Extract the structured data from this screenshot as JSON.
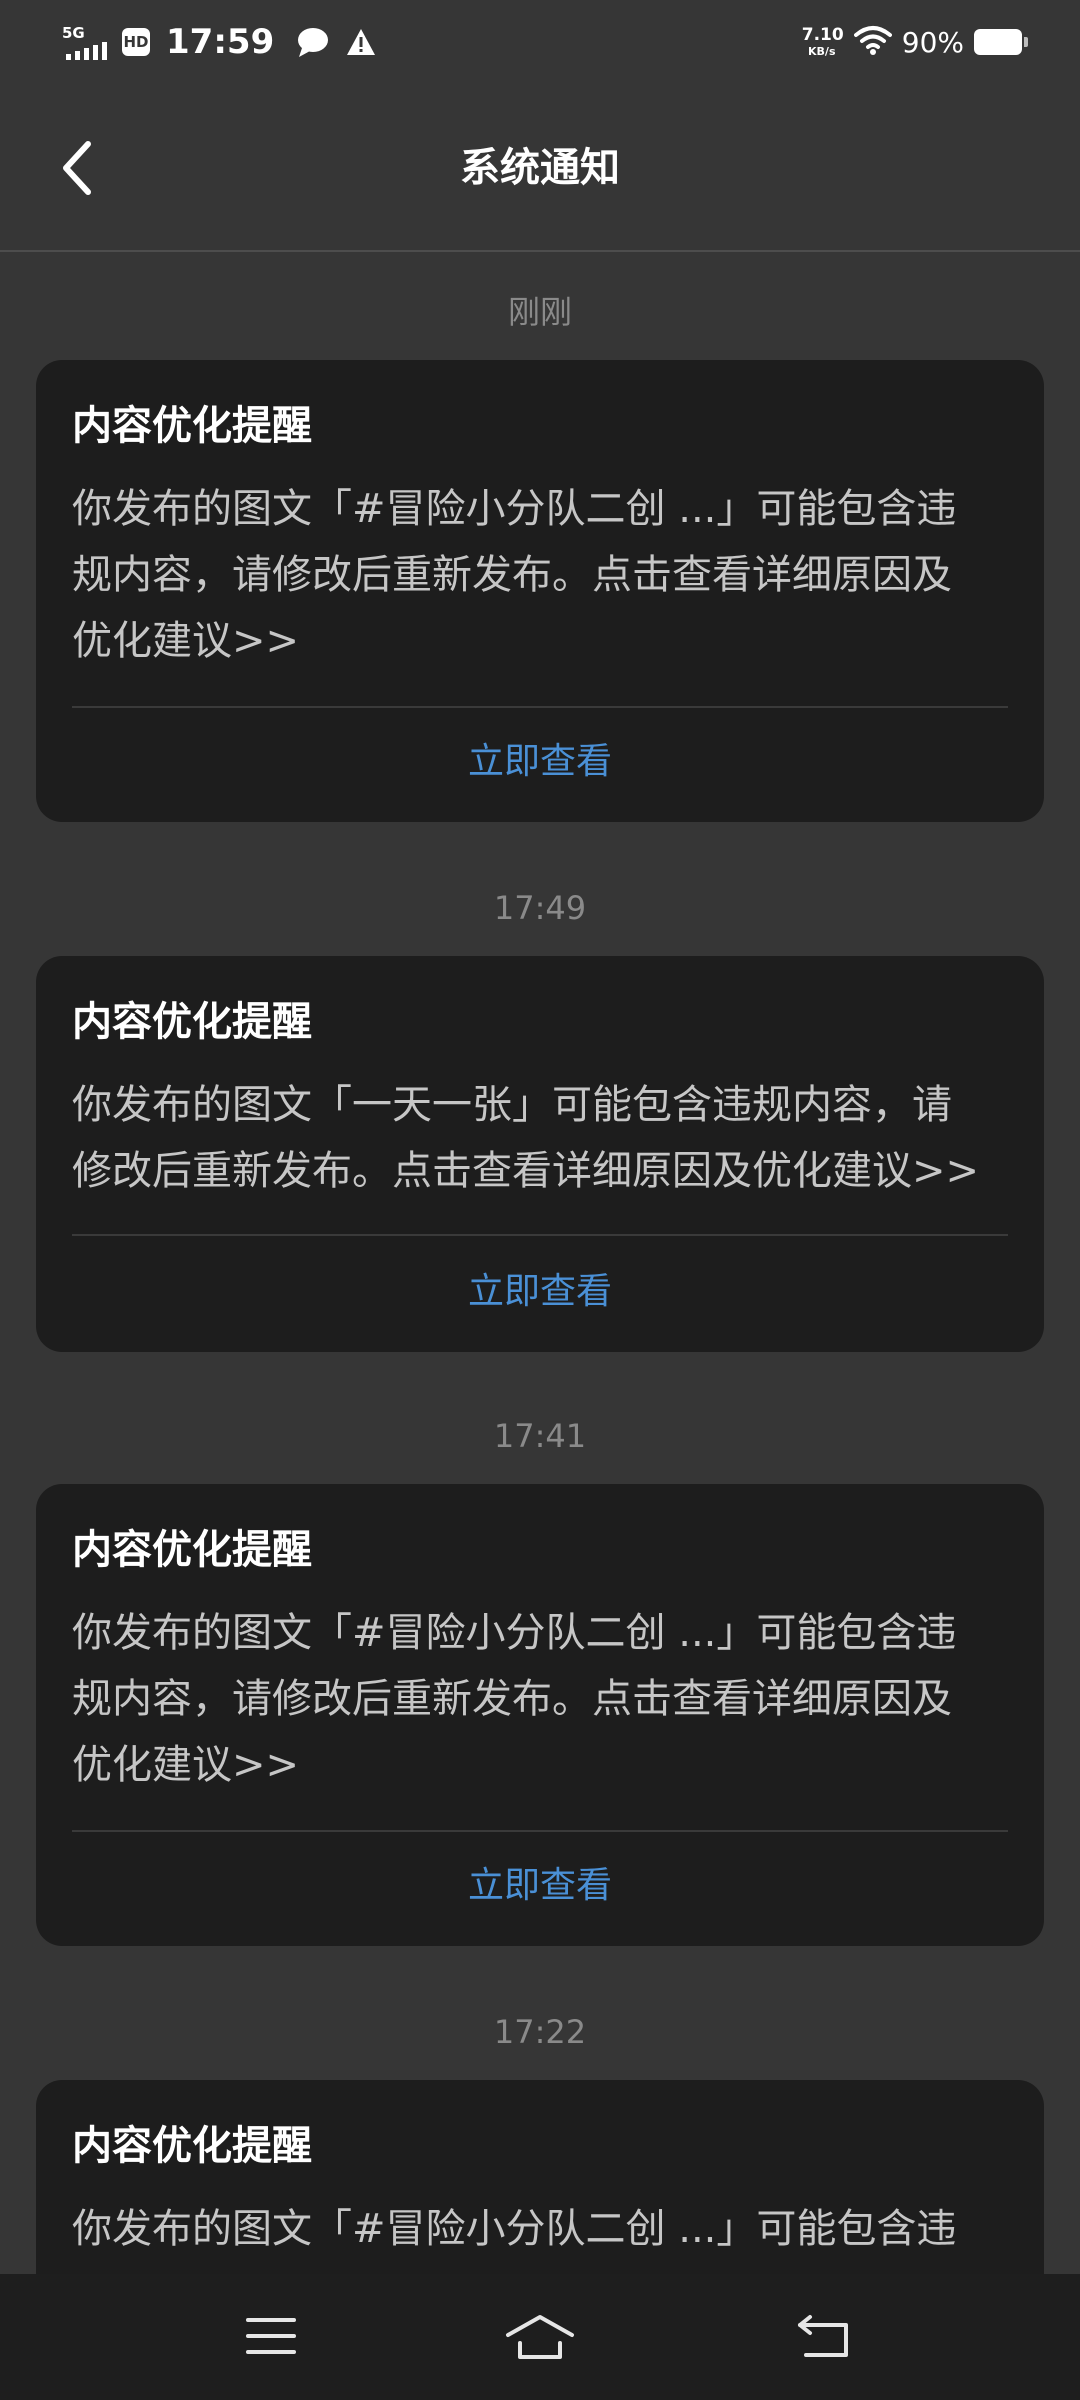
{
  "status_bar": {
    "network": "5G",
    "hd": "HD",
    "time": "17:59",
    "speed_value": "7.10",
    "speed_unit": "KB/s",
    "battery": "90%",
    "icons": [
      "signal-icon",
      "hd-icon",
      "message-icon",
      "warning-icon",
      "wifi-icon",
      "battery-icon"
    ]
  },
  "header": {
    "back_icon": "chevron-left-icon",
    "title": "系统通知"
  },
  "notifications": [
    {
      "time": "刚刚",
      "title": "内容优化提醒",
      "body_lines": [
        "你发布的图文「#冒险小分队二创 ...」可能包含违",
        "规内容，请修改后重新发布。点击查看详细原因及",
        "优化建议>>"
      ],
      "action": "立即查看"
    },
    {
      "time": "17:49",
      "title": "内容优化提醒",
      "body_lines": [
        "你发布的图文「一天一张」可能包含违规内容，请",
        "修改后重新发布。点击查看详细原因及优化建议>>"
      ],
      "action": "立即查看"
    },
    {
      "time": "17:41",
      "title": "内容优化提醒",
      "body_lines": [
        "你发布的图文「#冒险小分队二创 ...」可能包含违",
        "规内容，请修改后重新发布。点击查看详细原因及",
        "优化建议>>"
      ],
      "action": "立即查看"
    },
    {
      "time": "17:22",
      "title": "内容优化提醒",
      "body_lines": [
        "你发布的图文「#冒险小分队二创 ...」可能包含违"
      ],
      "action": ""
    }
  ],
  "bottom_nav": {
    "icons": [
      "menu-icon",
      "home-icon",
      "back-icon"
    ]
  },
  "colors": {
    "page_bg": "#363636",
    "card_bg": "#1d1d1d",
    "action_blue": "#4a90d6",
    "timestamp_gray": "#8a8a8a",
    "body_text": "#c6c6c6"
  }
}
